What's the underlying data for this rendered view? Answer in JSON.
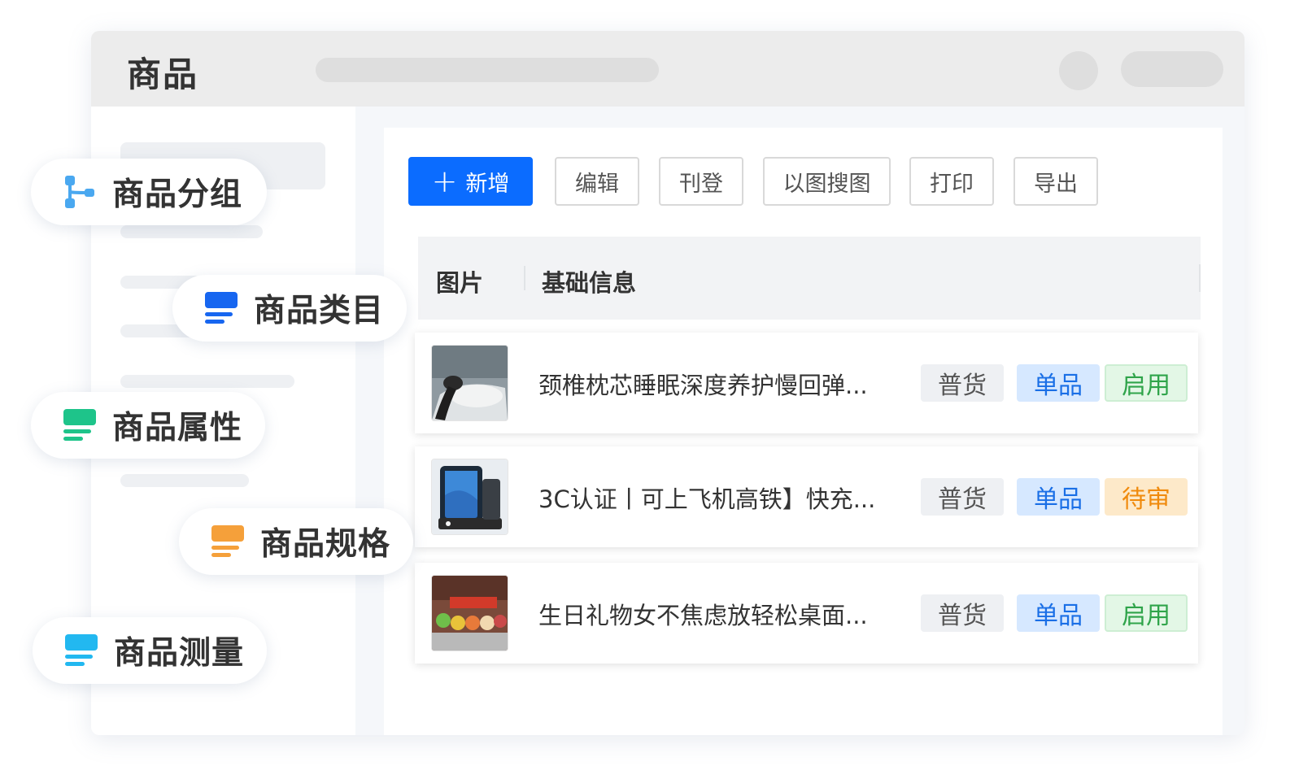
{
  "app": {
    "title": "商品"
  },
  "toolbar": {
    "add_label": "新增",
    "buttons": [
      "编辑",
      "刊登",
      "以图搜图",
      "打印",
      "导出"
    ]
  },
  "table": {
    "headers": [
      "图片",
      "基础信息"
    ],
    "rows": [
      {
        "title": "颈椎枕芯睡眠深度养护慢回弹...",
        "tags": [
          "普货",
          "单品",
          "启用"
        ],
        "status_color": "#2fa44a"
      },
      {
        "title": "3C认证丨可上飞机高铁】快充...",
        "tags": [
          "普货",
          "单品",
          "待审"
        ],
        "status_color": "#f08a0c"
      },
      {
        "title": "生日礼物女不焦虑放轻松桌面...",
        "tags": [
          "普货",
          "单品",
          "启用"
        ],
        "status_color": "#2fa44a"
      }
    ]
  },
  "feature_pills": [
    {
      "label": "商品分组",
      "icon": "tree-structure-icon",
      "color": "#4aa8f0"
    },
    {
      "label": "商品类目",
      "icon": "category-list-icon",
      "color": "#1766f0"
    },
    {
      "label": "商品属性",
      "icon": "attribute-list-icon",
      "color": "#1ec48a"
    },
    {
      "label": "商品规格",
      "icon": "spec-list-icon",
      "color": "#f5a03a"
    },
    {
      "label": "商品测量",
      "icon": "measure-list-icon",
      "color": "#22b8f0"
    }
  ],
  "colors": {
    "primary": "#0b6cff"
  }
}
